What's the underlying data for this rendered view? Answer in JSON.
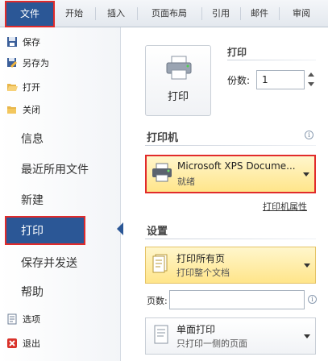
{
  "tabs": [
    {
      "label": "文件"
    },
    {
      "label": "开始"
    },
    {
      "label": "插入"
    },
    {
      "label": "页面布局"
    },
    {
      "label": "引用"
    },
    {
      "label": "邮件"
    },
    {
      "label": "审阅"
    }
  ],
  "nav": {
    "save": "保存",
    "save_as": "另存为",
    "open": "打开",
    "close": "关闭",
    "info": "信息",
    "recent": "最近所用文件",
    "new": "新建",
    "print": "打印",
    "save_send": "保存并发送",
    "help": "帮助",
    "options": "选项",
    "exit": "退出"
  },
  "print": {
    "heading": "打印",
    "button_label": "打印",
    "copies_label": "份数:",
    "copies_value": "1"
  },
  "printer": {
    "heading": "打印机",
    "name": "Microsoft XPS Docume...",
    "status": "就绪",
    "properties_link": "打印机属性"
  },
  "settings": {
    "heading": "设置",
    "range_title": "打印所有页",
    "range_desc": "打印整个文档",
    "pages_label": "页数:",
    "pages_value": "",
    "sides_title": "单面打印",
    "sides_desc": "只打印一侧的页面"
  },
  "colors": {
    "accent_blue": "#2b5796",
    "highlight_red": "#e12b2b",
    "dropdown_gold": "#ffe58a"
  }
}
